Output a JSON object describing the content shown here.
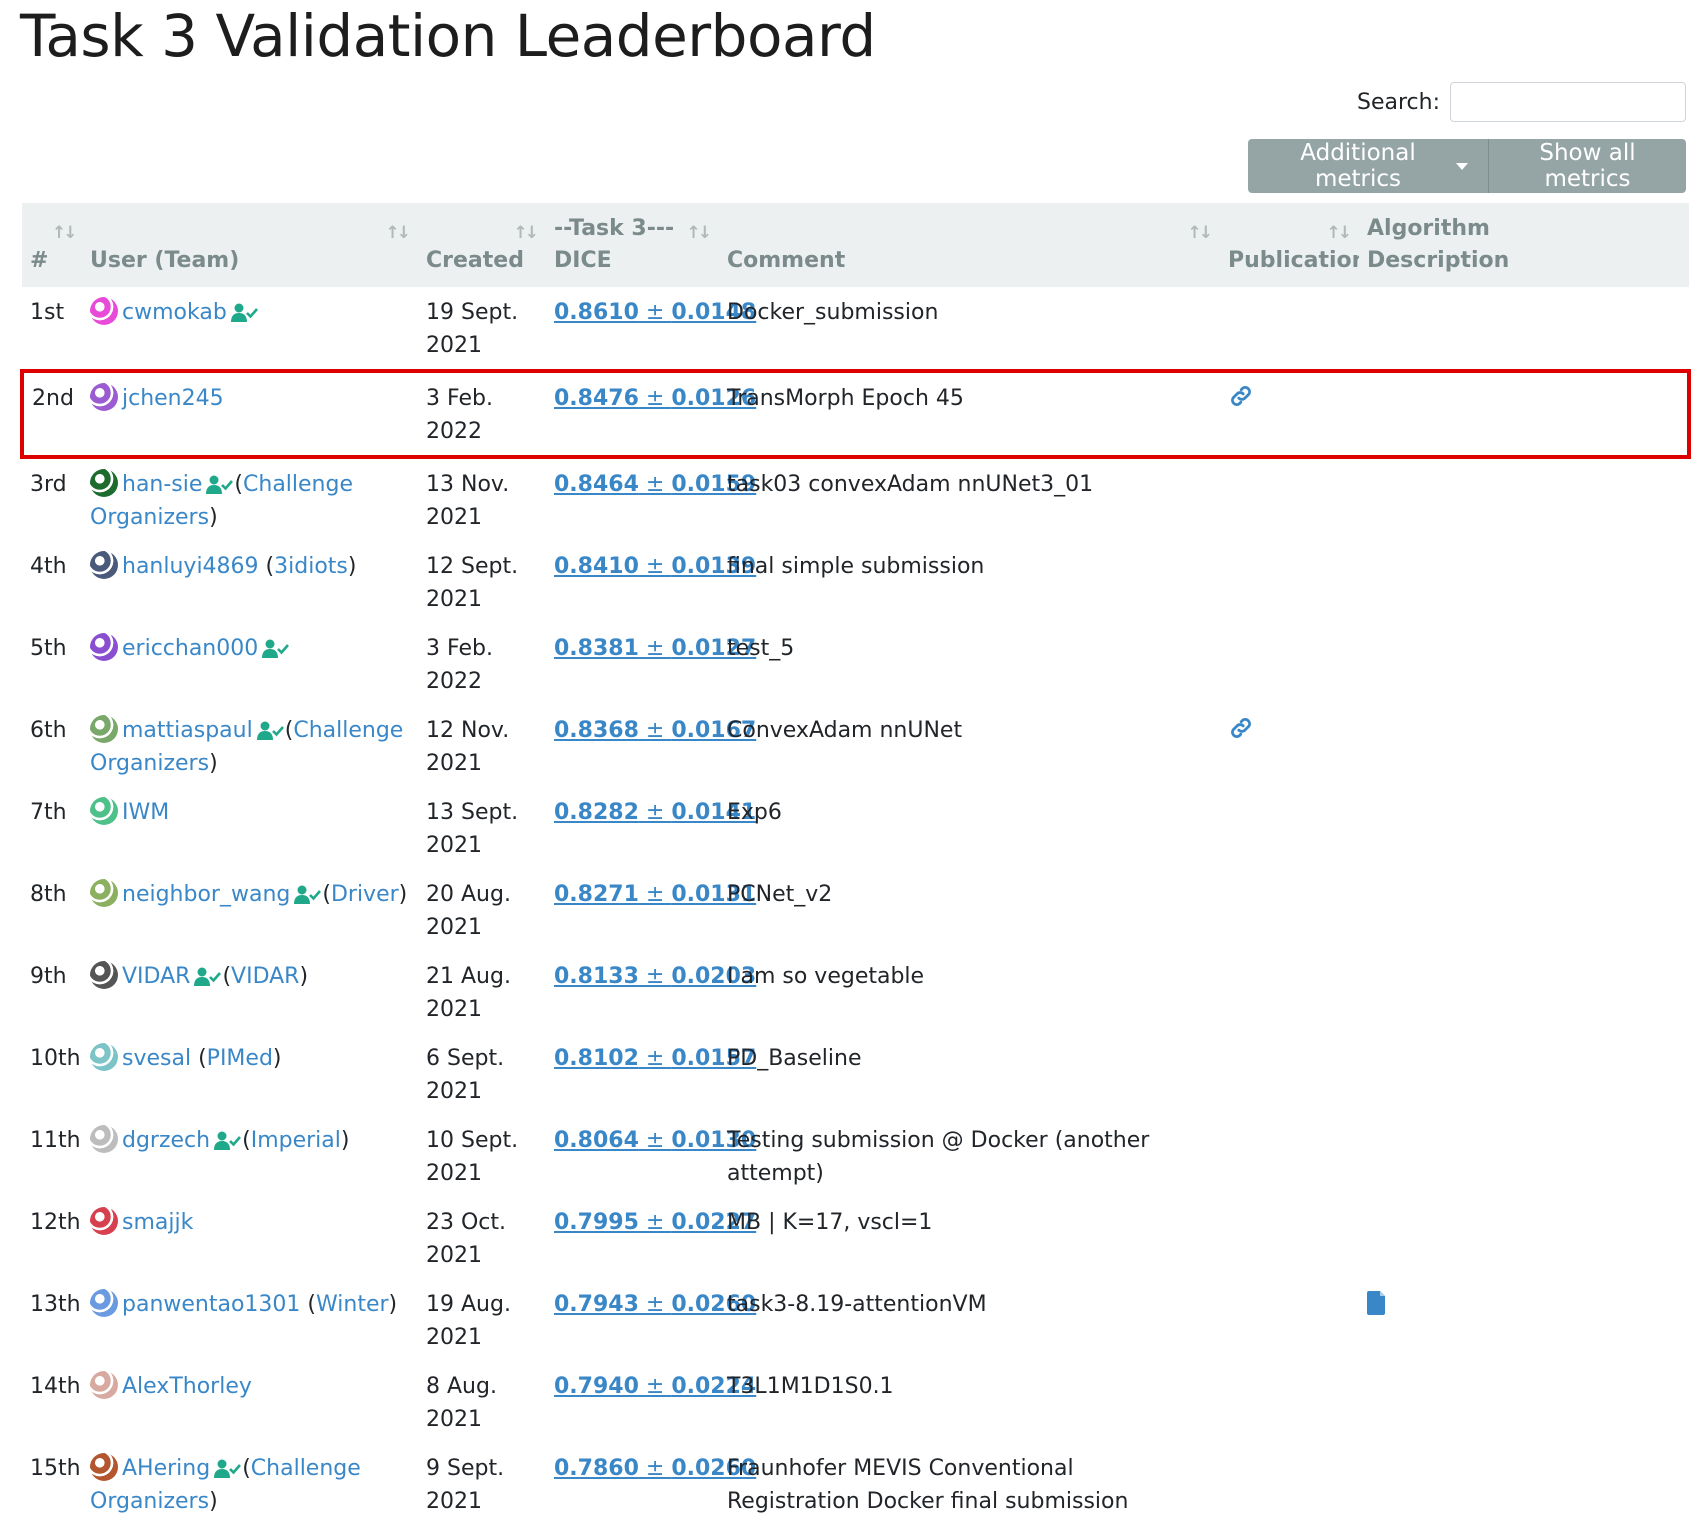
{
  "page": {
    "title": "Task 3 Validation Leaderboard"
  },
  "search": {
    "label": "Search:",
    "value": ""
  },
  "toolbar": {
    "additional_metrics": "Additional metrics",
    "show_all_metrics": "Show all metrics"
  },
  "columns": {
    "rank": "#",
    "user": "User (Team)",
    "created": "Created",
    "task_line1": "--Task 3---",
    "task_line2": "DICE",
    "comment": "Comment",
    "publication": "Publication",
    "algo_line1": "Algorithm",
    "algo_line2": "Description"
  },
  "colors": {
    "link": "#3a87c8",
    "verified": "#1fa98a",
    "header_bg": "#ecf0f1",
    "button_bg": "#95a5a6",
    "highlight": "#dd0000"
  },
  "rows": [
    {
      "rank": "1st",
      "user": "cwmokab",
      "verified": true,
      "team": "",
      "created": "19 Sept. 2021",
      "dice": "0.8610",
      "std": "0.0148",
      "comment": "Docker_submission",
      "publication": false,
      "algo_doc": false,
      "avatar": "#e84bd8"
    },
    {
      "rank": "2nd",
      "user": "jchen245",
      "verified": false,
      "team": "",
      "created": "3 Feb. 2022",
      "dice": "0.8476",
      "std": "0.0126",
      "comment": "TransMorph Epoch 45",
      "publication": true,
      "algo_doc": false,
      "avatar": "#9b5bd1"
    },
    {
      "rank": "3rd",
      "user": "han-sie",
      "verified": true,
      "team": "Challenge Organizers",
      "created": "13 Nov. 2021",
      "dice": "0.8464",
      "std": "0.0159",
      "comment": "task03 convexAdam nnUNet3_01",
      "publication": false,
      "algo_doc": false,
      "avatar": "#1e6b2e"
    },
    {
      "rank": "4th",
      "user": "hanluyi4869",
      "verified": false,
      "team": "3idiots",
      "created": "12 Sept. 2021",
      "dice": "0.8410",
      "std": "0.0139",
      "comment": "final simple submission",
      "publication": false,
      "algo_doc": false,
      "avatar": "#4a5a7a"
    },
    {
      "rank": "5th",
      "user": "ericchan000",
      "verified": true,
      "team": "",
      "created": "3 Feb. 2022",
      "dice": "0.8381",
      "std": "0.0127",
      "comment": "test_5",
      "publication": false,
      "algo_doc": false,
      "avatar": "#8a4fd1"
    },
    {
      "rank": "6th",
      "user": "mattiaspaul",
      "verified": true,
      "team": "Challenge Organizers",
      "created": "12 Nov. 2021",
      "dice": "0.8368",
      "std": "0.0167",
      "comment": "ConvexAdam nnUNet",
      "publication": true,
      "algo_doc": false,
      "avatar": "#7aa86b"
    },
    {
      "rank": "7th",
      "user": "IWM",
      "verified": false,
      "team": "",
      "created": "13 Sept. 2021",
      "dice": "0.8282",
      "std": "0.0141",
      "comment": "Exp6",
      "publication": false,
      "algo_doc": false,
      "avatar": "#4ec08a"
    },
    {
      "rank": "8th",
      "user": "neighbor_wang",
      "verified": true,
      "team": "Driver",
      "created": "20 Aug. 2021",
      "dice": "0.8271",
      "std": "0.0131",
      "comment": "PCNet_v2",
      "publication": false,
      "algo_doc": false,
      "avatar": "#8bb060"
    },
    {
      "rank": "9th",
      "user": "VIDAR",
      "verified": true,
      "team": "VIDAR",
      "created": "21 Aug. 2021",
      "dice": "0.8133",
      "std": "0.0203",
      "comment": "I am so vegetable",
      "publication": false,
      "algo_doc": false,
      "avatar": "#555555"
    },
    {
      "rank": "10th",
      "user": "svesal",
      "verified": false,
      "team": "PIMed",
      "created": "6 Sept. 2021",
      "dice": "0.8102",
      "std": "0.0157",
      "comment": "PD_Baseline",
      "publication": false,
      "algo_doc": false,
      "avatar": "#7cc4c8"
    },
    {
      "rank": "11th",
      "user": "dgrzech",
      "verified": true,
      "team": "Imperial",
      "created": "10 Sept. 2021",
      "dice": "0.8064",
      "std": "0.0130",
      "comment": "Testing submission @ Docker (another attempt)",
      "publication": false,
      "algo_doc": false,
      "avatar": "#bdbdbd"
    },
    {
      "rank": "12th",
      "user": "smajjk",
      "verified": false,
      "team": "",
      "created": "23 Oct. 2021",
      "dice": "0.7995",
      "std": "0.0227",
      "comment": "MB | K=17, vscl=1",
      "publication": false,
      "algo_doc": false,
      "avatar": "#d6404f"
    },
    {
      "rank": "13th",
      "user": "panwentao1301",
      "verified": false,
      "team": "Winter",
      "created": "19 Aug. 2021",
      "dice": "0.7943",
      "std": "0.0260",
      "comment": "task3-8.19-attentionVM",
      "publication": false,
      "algo_doc": true,
      "avatar": "#6a9be0"
    },
    {
      "rank": "14th",
      "user": "AlexThorley",
      "verified": false,
      "team": "",
      "created": "8 Aug. 2021",
      "dice": "0.7940",
      "std": "0.0224",
      "comment": "T3L1M1D1S0.1",
      "publication": false,
      "algo_doc": false,
      "avatar": "#d8a9a0"
    },
    {
      "rank": "15th",
      "user": "AHering",
      "verified": true,
      "team": "Challenge Organizers",
      "created": "9 Sept. 2021",
      "dice": "0.7860",
      "std": "0.0260",
      "comment": "Fraunhofer MEVIS Conventional Registration Docker final submission",
      "publication": false,
      "algo_doc": false,
      "avatar": "#b3562f"
    }
  ]
}
